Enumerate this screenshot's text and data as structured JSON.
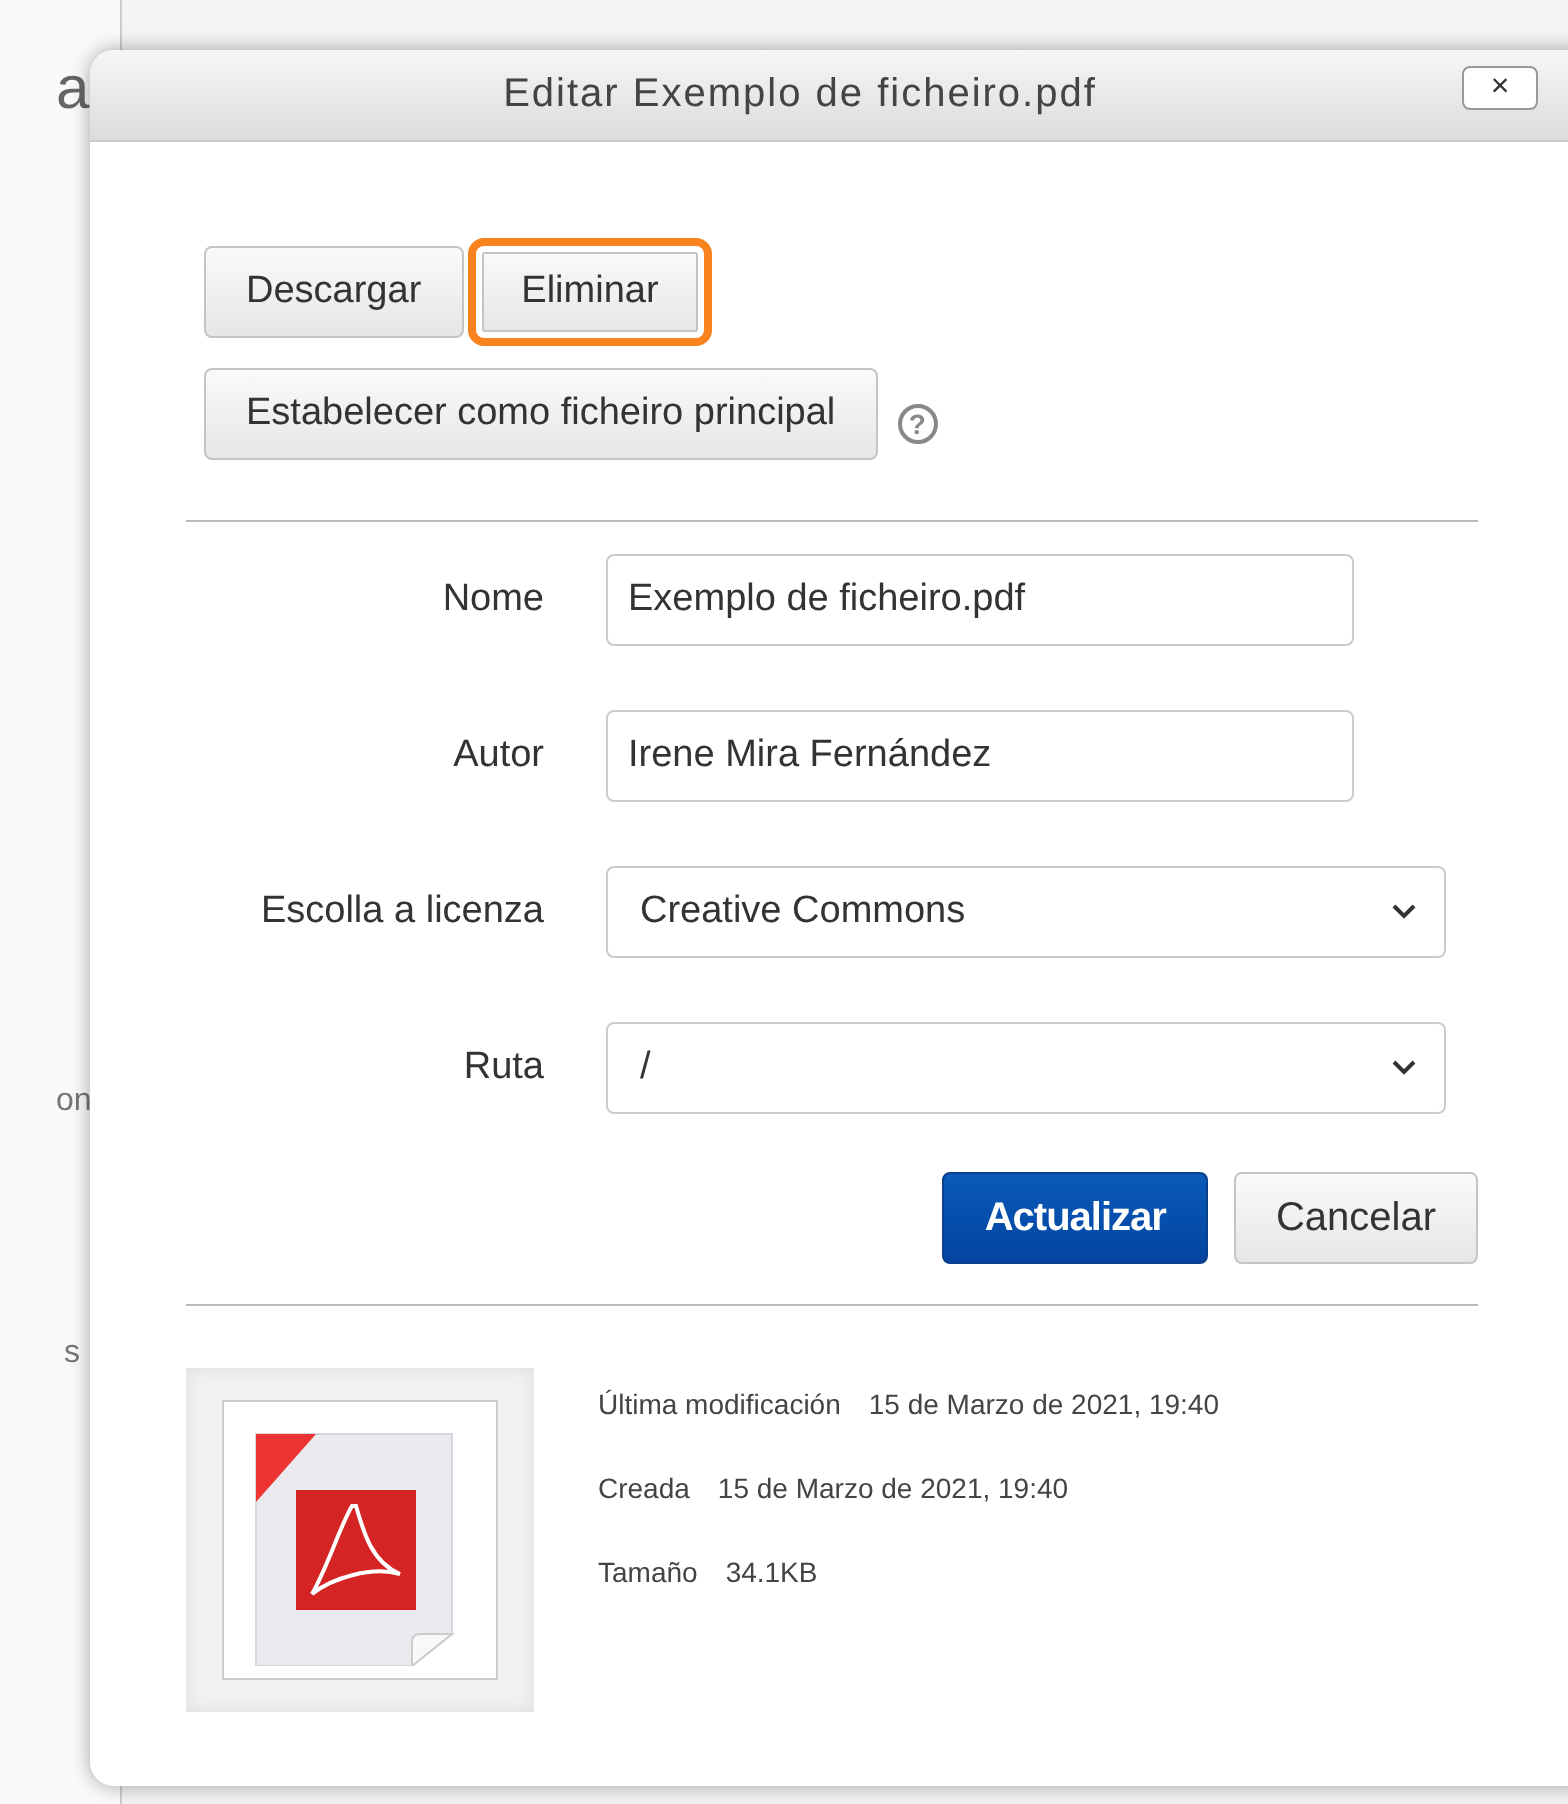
{
  "background_fragments": [
    "a",
    "on",
    "s"
  ],
  "dialog": {
    "title": "Editar Exemplo de ficheiro.pdf",
    "close": "×"
  },
  "actions": [
    {
      "label": "Descargar",
      "highlighted": false
    },
    {
      "label": "Eliminar",
      "highlighted": true
    }
  ],
  "main_file_button": {
    "label": "Estabelecer como ficheiro principal",
    "help": "?"
  },
  "fields": [
    {
      "kind": "text",
      "label": "Nome",
      "value": "Exemplo de ficheiro.pdf"
    },
    {
      "kind": "text",
      "label": "Autor",
      "value": "Irene Mira Fernández"
    },
    {
      "kind": "select",
      "label": "Escolla a licenza",
      "value": "Creative Commons"
    },
    {
      "kind": "select",
      "label": "Ruta",
      "value": "/"
    }
  ],
  "buttons": [
    {
      "label": "Actualizar",
      "primary": true
    },
    {
      "label": "Cancelar",
      "primary": false
    }
  ],
  "file_info": [
    {
      "label": "Última modificación",
      "value": "15 de Marzo de 2021, 19:40"
    },
    {
      "label": "Creada",
      "value": "15 de Marzo de 2021, 19:40"
    },
    {
      "label": "Tamaño",
      "value": "34.1KB"
    }
  ]
}
